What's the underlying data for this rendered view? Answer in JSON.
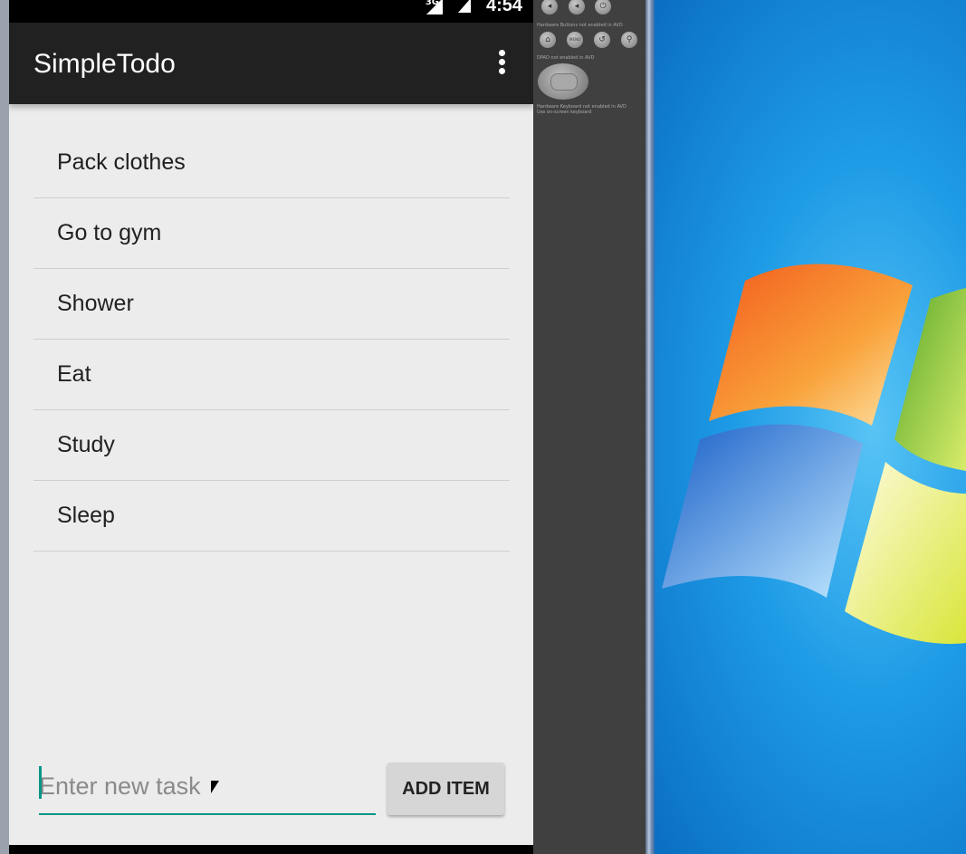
{
  "status_bar": {
    "network": "3G",
    "time": "4:54"
  },
  "app_bar": {
    "title": "SimpleTodo",
    "overflow_icon": "more-vert-icon"
  },
  "todo_list": {
    "items": [
      {
        "label": "Pack clothes"
      },
      {
        "label": "Go to gym"
      },
      {
        "label": "Shower"
      },
      {
        "label": "Eat"
      },
      {
        "label": "Study"
      },
      {
        "label": "Sleep"
      }
    ]
  },
  "new_task": {
    "placeholder": "Enter new task",
    "value": ""
  },
  "add_button": {
    "label": "ADD ITEM"
  },
  "emulator_panel": {
    "hardware_buttons_note": "Hardware Buttons not enabled in AVD",
    "dpad_note": "DPAD not enabled in AVD",
    "keyboard_note": "Hardware Keyboard not enabled in AVD",
    "keyboard_note_2": "Use on-screen keyboard",
    "menu_label": "MENU"
  },
  "colors": {
    "app_bar": "#212121",
    "accent": "#009688",
    "list_background": "#ececec"
  }
}
